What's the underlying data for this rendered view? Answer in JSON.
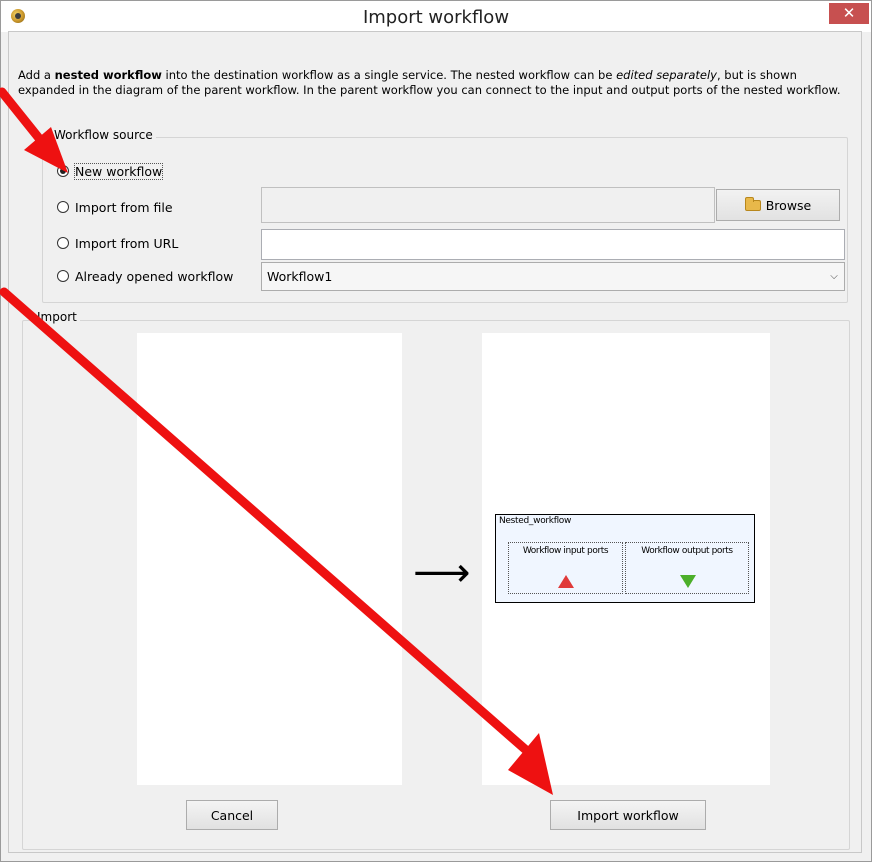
{
  "window": {
    "title": "Import workflow",
    "close_glyph": "✕"
  },
  "description": {
    "part1": "Add a ",
    "bold": "nested workflow",
    "part2": " into the destination workflow as a single service. The nested workflow can be ",
    "italic": "edited separately",
    "part3": ", but is shown expanded in the diagram of the parent workflow. In the parent workflow you can connect to the input and output ports of the nested workflow."
  },
  "source": {
    "legend": "Workflow source",
    "options": [
      {
        "label": "New workflow",
        "checked": true
      },
      {
        "label": "Import from file",
        "checked": false
      },
      {
        "label": "Import from URL",
        "checked": false
      },
      {
        "label": "Already opened workflow",
        "checked": false
      }
    ],
    "file_path": "",
    "url": "",
    "browse_label": "Browse",
    "opened_workflow_selected": "Workflow1"
  },
  "import": {
    "legend": "Import",
    "arrow_glyph": "⟶",
    "nested": {
      "title": "Nested_workflow",
      "input_ports_label": "Workflow input ports",
      "output_ports_label": "Workflow output ports"
    },
    "cancel_label": "Cancel",
    "import_label": "Import workflow"
  },
  "colors": {
    "close_button": "#c75050",
    "annotation_arrow": "#ee1111",
    "input_port": "#e03a3a",
    "output_port": "#4caf2a"
  }
}
